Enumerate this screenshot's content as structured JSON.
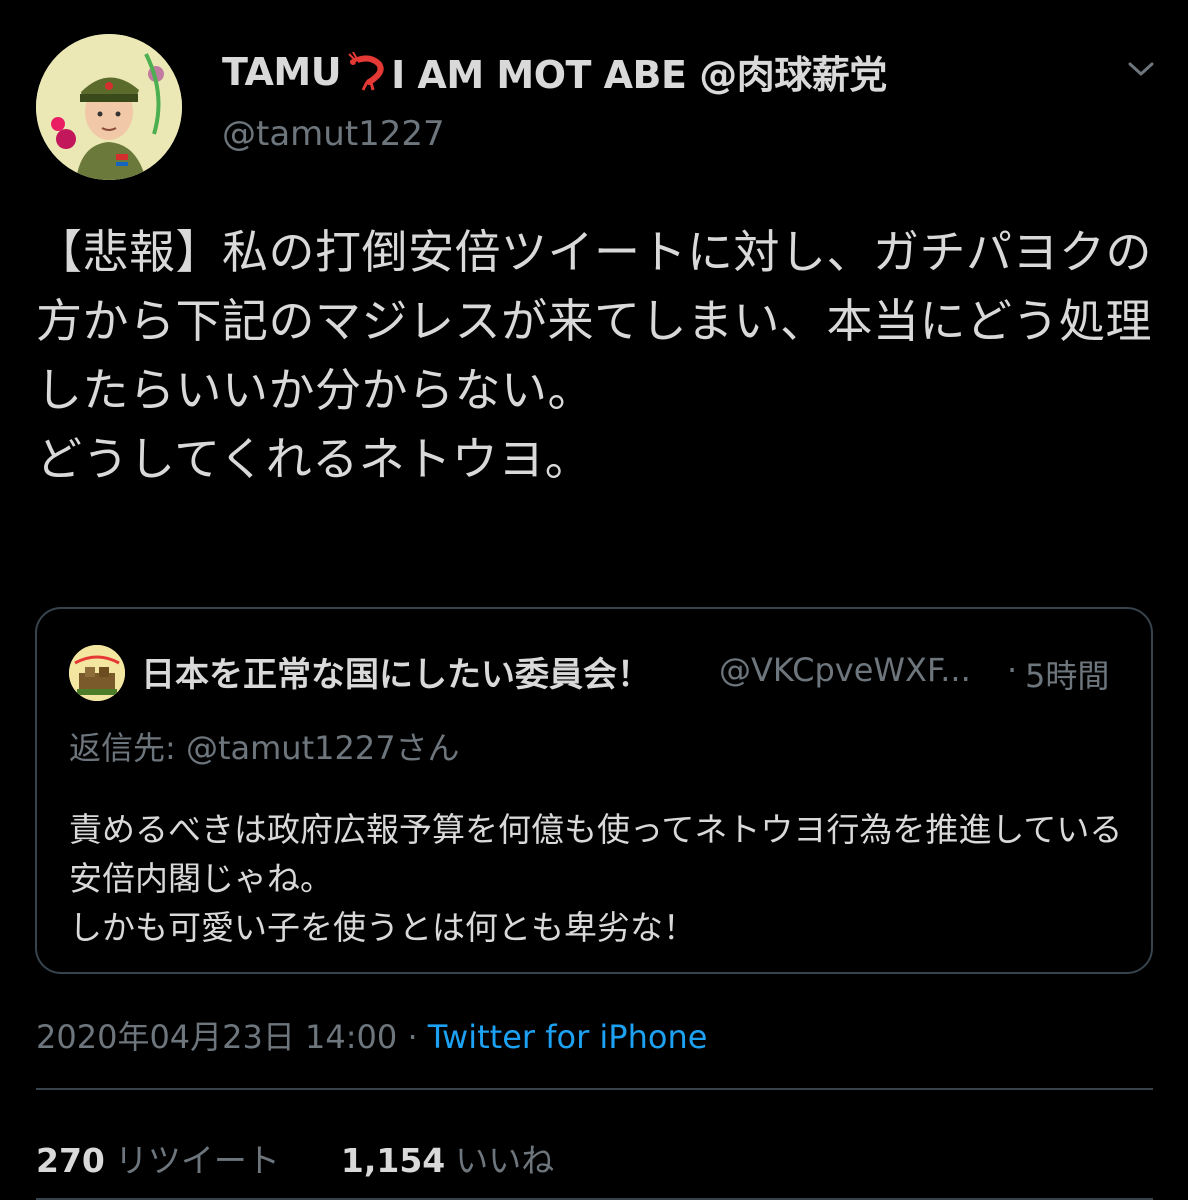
{
  "author": {
    "display_name": "TAMU",
    "emoji_icon": "shrimp-icon",
    "display_name_rest": "I AM MOT ABE @肉球薪党",
    "handle": "@tamut1227"
  },
  "tweet": {
    "text": "【悲報】私の打倒安倍ツイートに対し、ガチパヨクの方から下記のマジレスが来てしまい、本当にどう処理したらいいか分からない。\nどうしてくれるネトウヨ。",
    "timestamp": "2020年04月23日 14:00",
    "separator": "·",
    "source": "Twitter for iPhone"
  },
  "quoted": {
    "name": "日本を正常な国にしたい委員会！",
    "handle": "@VKCpveWXF...",
    "separator": "·",
    "time": "5時間",
    "reply_to": "返信先: @tamut1227さん",
    "text": "責めるべきは政府広報予算を何億も使ってネトウヨ行為を推進している安倍内閣じゃね。\nしかも可愛い子を使うとは何とも卑劣な！"
  },
  "stats": {
    "retweets_count": "270",
    "retweets_label": "リツイート",
    "likes_count": "1,154",
    "likes_label": "いいね"
  },
  "colors": {
    "background": "#000000",
    "text": "#d9d9d9",
    "secondary": "#6e767d",
    "link": "#1da1f2",
    "border": "#38444d"
  }
}
